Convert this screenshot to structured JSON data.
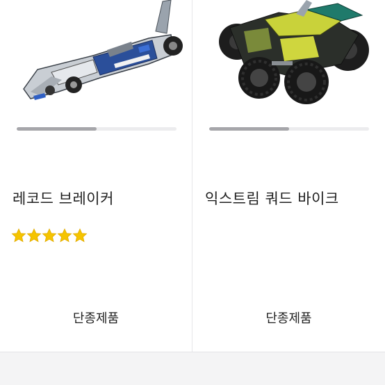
{
  "products": [
    {
      "name": "레코드 브레이커",
      "image_icon": "race-car-lego-image",
      "slide_progress": 0.5,
      "rating": 5,
      "rating_max": 5,
      "status": "단종제품"
    },
    {
      "name": "익스트림 쿼드 바이크",
      "image_icon": "quad-bike-lego-image",
      "slide_progress": 0.5,
      "rating": 0,
      "rating_max": 5,
      "status": "단종제품"
    }
  ],
  "colors": {
    "star": "#f5c400",
    "progress_fill": "#a6a6aa",
    "progress_track": "#ececee"
  }
}
